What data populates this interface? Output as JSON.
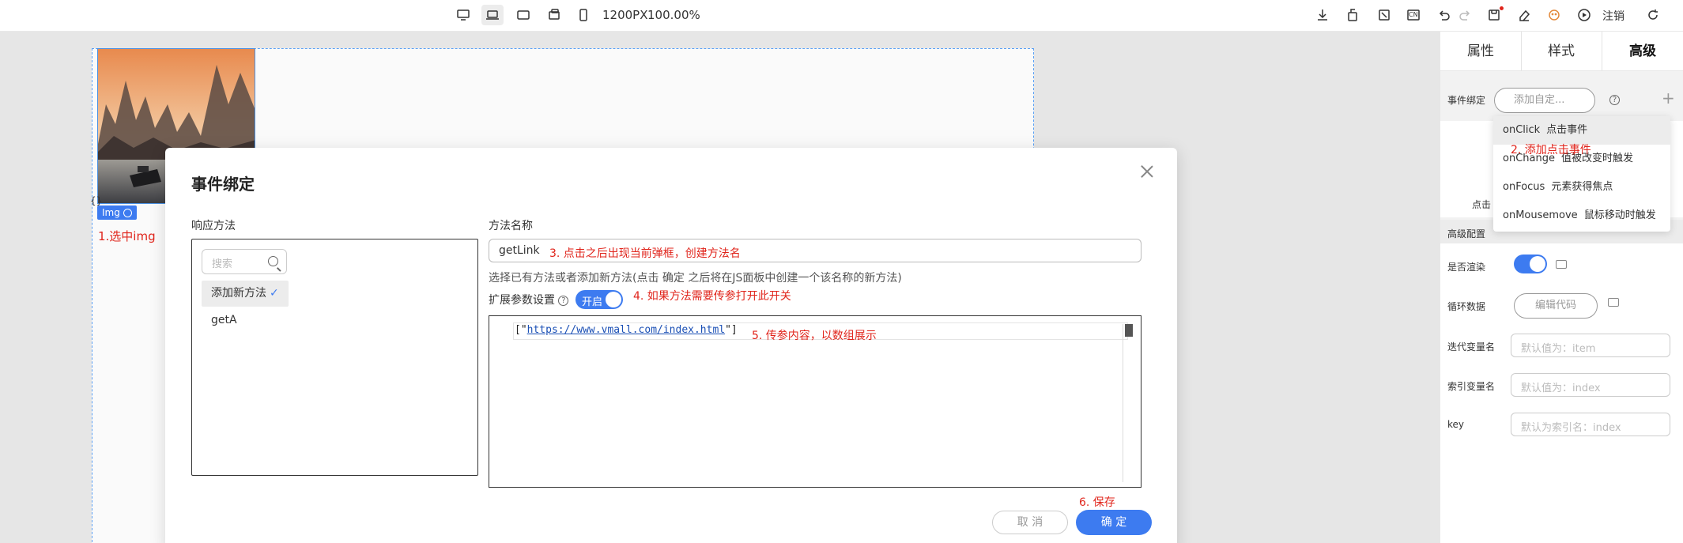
{
  "toolbar": {
    "resolution": "1200PX",
    "zoom": "100.00%",
    "logout": "注销",
    "lang": "CN"
  },
  "canvas": {
    "img_badge": "Img",
    "brace": "{}"
  },
  "annotations": {
    "a1": "1.选中img",
    "a2": "2. 添加点击事件",
    "a3": "3. 点击之后出现当前弹框，创建方法名",
    "a4": "4. 如果方法需要传参打开此开关",
    "a5": "5. 传参内容，以数组展示",
    "a6": "6. 保存"
  },
  "modal": {
    "title": "事件绑定",
    "response_label": "响应方法",
    "search_placeholder": "搜索",
    "methods": [
      {
        "label": "添加新方法",
        "check": "✓"
      },
      {
        "label": "getA"
      }
    ],
    "method_name_label": "方法名称",
    "method_name_value": "getLink",
    "hint": "选择已有方法或者添加新方法(点击 确定 之后将在JS面板中创建一个该名称的新方法)",
    "ext_param_label": "扩展参数设置",
    "help": "?",
    "toggle_label": "开启",
    "code_prefix": "[\"",
    "code_url": "https://www.vmall.com/index.html",
    "code_suffix": "\"]",
    "cancel": "取 消",
    "ok": "确 定"
  },
  "rpanel": {
    "tabs": [
      "属性",
      "样式",
      "高级"
    ],
    "event_bind_label": "事件绑定",
    "add_custom_placeholder": "添加自定...",
    "help": "?",
    "plus": "+",
    "dropdown": [
      {
        "event": "onClick",
        "desc": "点击事件"
      },
      {
        "event": "onChange",
        "desc": "值被改变时触发"
      },
      {
        "event": "onFocus",
        "desc": "元素获得焦点"
      },
      {
        "event": "onMousemove",
        "desc": "鼠标移动时触发"
      }
    ],
    "partial_text": "点击",
    "adv_config": "高级配置",
    "render_label": "是否渲染",
    "loop_label": "循环数据",
    "edit_code": "编辑代码",
    "iter_label": "迭代变量名",
    "iter_placeholder": "默认值为：item",
    "index_label": "索引变量名",
    "index_placeholder": "默认值为：index",
    "key_label": "key",
    "key_placeholder": "默认为索引名：index"
  },
  "colors": {
    "accent": "#3d7bf0",
    "annotation": "#e0241b"
  }
}
